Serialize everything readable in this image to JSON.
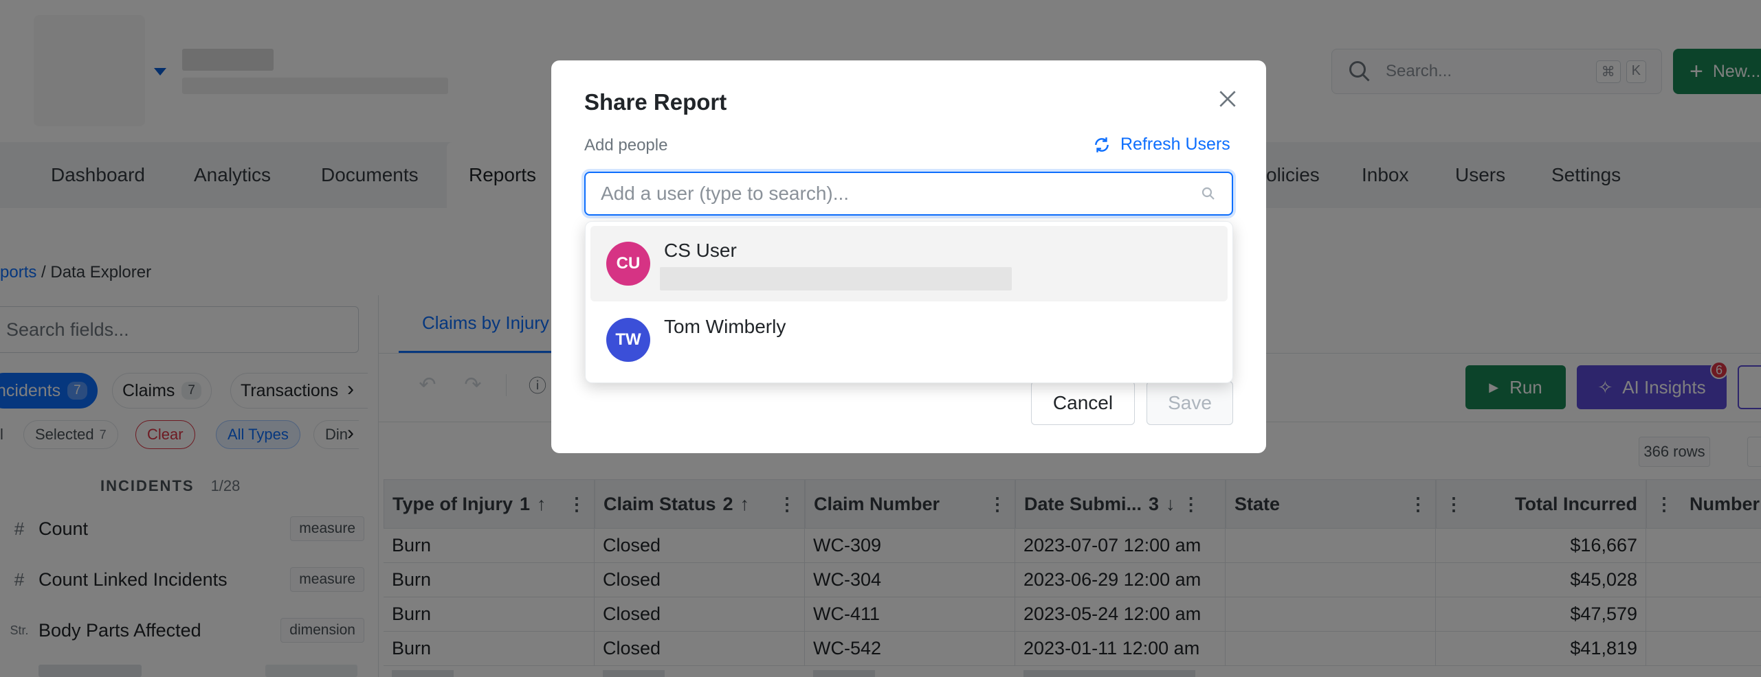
{
  "header": {
    "search_placeholder": "Search...",
    "kbd_1": "⌘",
    "kbd_2": "K",
    "new_label": "New..."
  },
  "nav": {
    "items": [
      "Dashboard",
      "Analytics",
      "Documents",
      "Reports",
      "olicies",
      "Inbox",
      "Users",
      "Settings"
    ],
    "active": "Reports"
  },
  "breadcrumb": {
    "parent": "ports",
    "separator": "/",
    "current": "Data Explorer"
  },
  "left_panel": {
    "search_placeholder": "Search fields...",
    "entity_tabs": [
      {
        "label": "ncidents",
        "count": "7"
      },
      {
        "label": "Claims",
        "count": "7"
      },
      {
        "label": "Transactions",
        "count": ""
      }
    ],
    "filter_chips": {
      "all": "l",
      "selected": "Selected",
      "selected_count": "7",
      "clear": "Clear",
      "all_types": "All Types",
      "dim": "Din"
    },
    "section": {
      "title": "INCIDENTS",
      "count": "1/28"
    },
    "fields": [
      {
        "icon": "#",
        "name": "Count",
        "tag": "measure"
      },
      {
        "icon": "#",
        "name": "Count Linked Incidents",
        "tag": "measure"
      },
      {
        "icon": "Str.",
        "name": "Body Parts Affected",
        "tag": "dimension"
      }
    ]
  },
  "main": {
    "tab_label": "Claims by Injury",
    "run_label": "Run",
    "ai_label": "AI Insights",
    "ai_badge": "6",
    "row_count": "366 rows",
    "table": {
      "columns": [
        {
          "label": "Type of Injury",
          "sort": "1",
          "dir": "↑"
        },
        {
          "label": "Claim Status",
          "sort": "2",
          "dir": "↑"
        },
        {
          "label": "Claim Number",
          "sort": "",
          "dir": ""
        },
        {
          "label": "Date Submi...",
          "sort": "3",
          "dir": "↓"
        },
        {
          "label": "State",
          "sort": "",
          "dir": ""
        },
        {
          "label": "Total Incurred",
          "sort": "",
          "dir": ""
        },
        {
          "label": "Number",
          "sort": "",
          "dir": ""
        }
      ],
      "rows": [
        [
          "Burn",
          "Closed",
          "WC-309",
          "2023-07-07 12:00 am",
          "",
          "$16,667",
          ""
        ],
        [
          "Burn",
          "Closed",
          "WC-304",
          "2023-06-29 12:00 am",
          "",
          "$45,028",
          ""
        ],
        [
          "Burn",
          "Closed",
          "WC-411",
          "2023-05-24 12:00 am",
          "",
          "$47,579",
          ""
        ],
        [
          "Burn",
          "Closed",
          "WC-542",
          "2023-01-11 12:00 am",
          "",
          "$41,819",
          ""
        ]
      ]
    }
  },
  "modal": {
    "title": "Share Report",
    "add_people_label": "Add people",
    "refresh_label": "Refresh Users",
    "input_placeholder": "Add a user (type to search)...",
    "users": [
      {
        "initials": "CU",
        "name": "CS User",
        "color": "#d63384"
      },
      {
        "initials": "TW",
        "name": "Tom Wimberly",
        "color": "#3b4fd8"
      }
    ],
    "cancel_label": "Cancel",
    "save_label": "Save"
  }
}
